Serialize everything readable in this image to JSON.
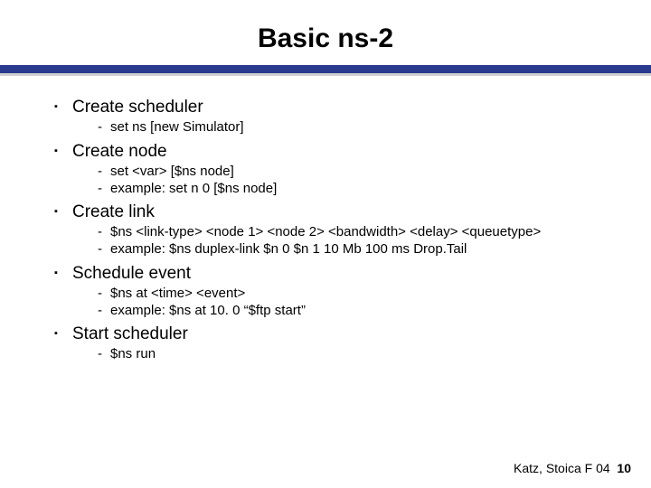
{
  "title": "Basic ns-2",
  "bullets": {
    "b0": {
      "label": "Create scheduler",
      "s0": "set ns [new Simulator]"
    },
    "b1": {
      "label": "Create node",
      "s0": "set <var> [$ns node]",
      "s1": "example: set n 0 [$ns node]"
    },
    "b2": {
      "label": "Create link",
      "s0": "$ns <link-type> <node 1> <node 2> <bandwidth> <delay> <queuetype>",
      "s1": "example: $ns duplex-link $n 0 $n 1 10 Mb 100 ms Drop.Tail"
    },
    "b3": {
      "label": "Schedule event",
      "s0": "$ns at <time> <event>",
      "s1": "example: $ns at 10. 0 “$ftp start”"
    },
    "b4": {
      "label": "Start scheduler",
      "s0": "$ns run"
    }
  },
  "footer": {
    "text": "Katz, Stoica F 04",
    "page": "10"
  }
}
